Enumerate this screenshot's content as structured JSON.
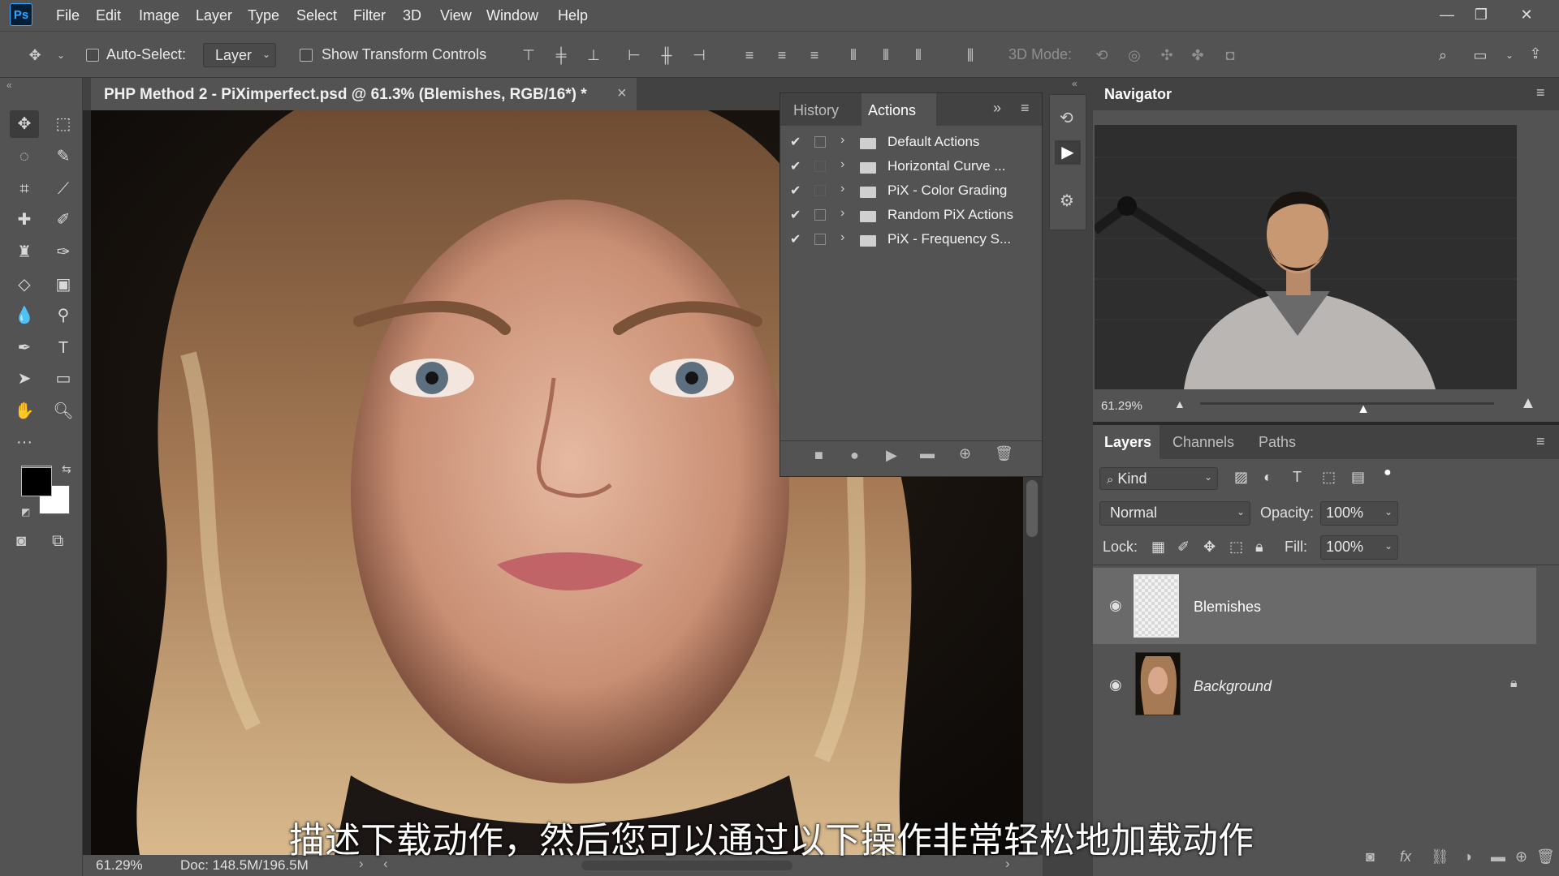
{
  "app": {
    "logo_text": "Ps"
  },
  "menu": [
    "File",
    "Edit",
    "Image",
    "Layer",
    "Type",
    "Select",
    "Filter",
    "3D",
    "View",
    "Window",
    "Help"
  ],
  "window_controls": {
    "minimize": "—",
    "restore": "❐",
    "close": "✕"
  },
  "options_bar": {
    "auto_select_label": "Auto-Select:",
    "auto_select_value": "Layer",
    "transform_label": "Show Transform Controls",
    "mode_3d_label": "3D Mode:"
  },
  "document": {
    "tab_title": "PHP Method 2 - PiXimperfect.psd @ 61.3% (Blemishes, RGB/16*) *",
    "close_glyph": "×",
    "zoom": "61.29%",
    "doc_size": "Doc: 148.5M/196.5M"
  },
  "actions_panel": {
    "tabs": [
      "History",
      "Actions"
    ],
    "active_tab": "Actions",
    "items": [
      {
        "label": "Default Actions",
        "checked": true,
        "dialog": true
      },
      {
        "label": "Horizontal Curve ...",
        "checked": true,
        "dialog": false
      },
      {
        "label": "PiX - Color Grading",
        "checked": true,
        "dialog": false
      },
      {
        "label": "Random PiX Actions",
        "checked": true,
        "dialog": true
      },
      {
        "label": "PiX - Frequency S...",
        "checked": true,
        "dialog": true
      }
    ]
  },
  "navigator": {
    "title": "Navigator",
    "zoom": "61.29%",
    "zoom_fraction": 0.55
  },
  "layers_panel": {
    "tabs": [
      "Layers",
      "Channels",
      "Paths"
    ],
    "active_tab": "Layers",
    "filter_label": "Kind",
    "blend_mode": "Normal",
    "opacity_label": "Opacity:",
    "opacity_value": "100%",
    "lock_label": "Lock:",
    "fill_label": "Fill:",
    "fill_value": "100%",
    "layers": [
      {
        "name": "Blemishes",
        "selected": true,
        "locked": false
      },
      {
        "name": "Background",
        "selected": false,
        "locked": true
      }
    ]
  },
  "subtitle": "描述下载动作，然后您可以通过以下操作非常轻松地加载动作",
  "colors": {
    "ui_gray": "#535353",
    "dark_gray": "#424242",
    "accent": "#31a8ff",
    "foreground_swatch": "#000000",
    "background_swatch": "#ffffff"
  }
}
